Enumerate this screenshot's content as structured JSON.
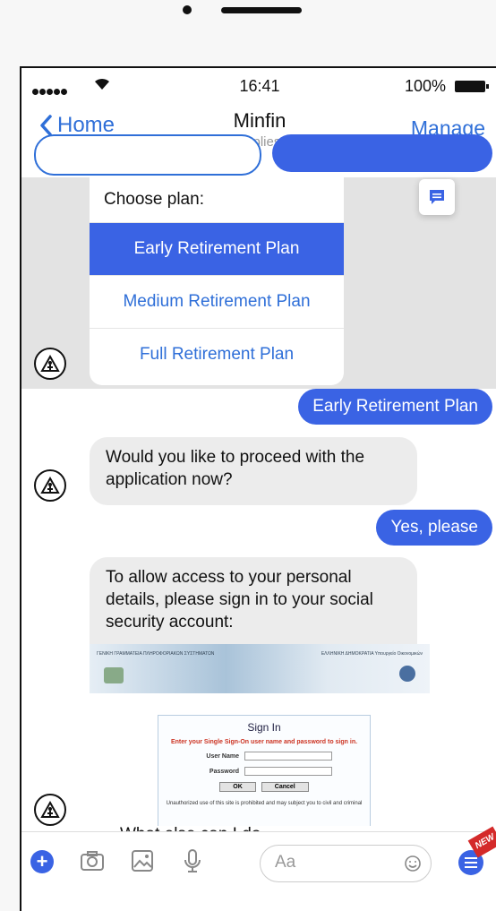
{
  "status": {
    "time": "16:41",
    "battery": "100%"
  },
  "nav": {
    "back_label": "Home",
    "title": "Minfin",
    "subtitle": "Typically replies instantly",
    "manage_label": "Manage"
  },
  "plan_card": {
    "title": "Choose plan:",
    "options": [
      "Early Retirement Plan",
      "Medium Retirement Plan",
      "Full Retirement Plan"
    ],
    "selected_index": 0
  },
  "messages": {
    "user_1": "Early Retirement Plan",
    "bot_1": "Would you like to proceed with the application now?",
    "user_2": "Yes, please",
    "bot_2": "To allow access to your personal details, please sign in to your social security account:"
  },
  "signin_preview": {
    "header_left": "ΓΕΝΙΚΗ ΓΡΑΜΜΑΤΕΙΑ ΠΛΗΡΟΦΟΡΙΑΚΩΝ ΣΥΣΤΗΜΑΤΩΝ",
    "header_right": "ΕΛΛΗΝΙΚΗ ΔΗΜΟΚΡΑΤΙΑ Υπουργείο Οικονομικών",
    "title": "Sign In",
    "instructions": "Enter your Single Sign-On user name and password to sign in.",
    "user_label": "User Name",
    "password_label": "Password",
    "ok_label": "OK",
    "cancel_label": "Cancel",
    "warning": "Unauthorized use of this site is prohibited and may subject you to civil and criminal"
  },
  "partial_message": "What else can I do",
  "composer": {
    "placeholder": "Aa",
    "new_badge": "NEW"
  },
  "colors": {
    "accent": "#3a63e4",
    "link": "#2f6fd8",
    "bubble_gray": "#ececec"
  }
}
